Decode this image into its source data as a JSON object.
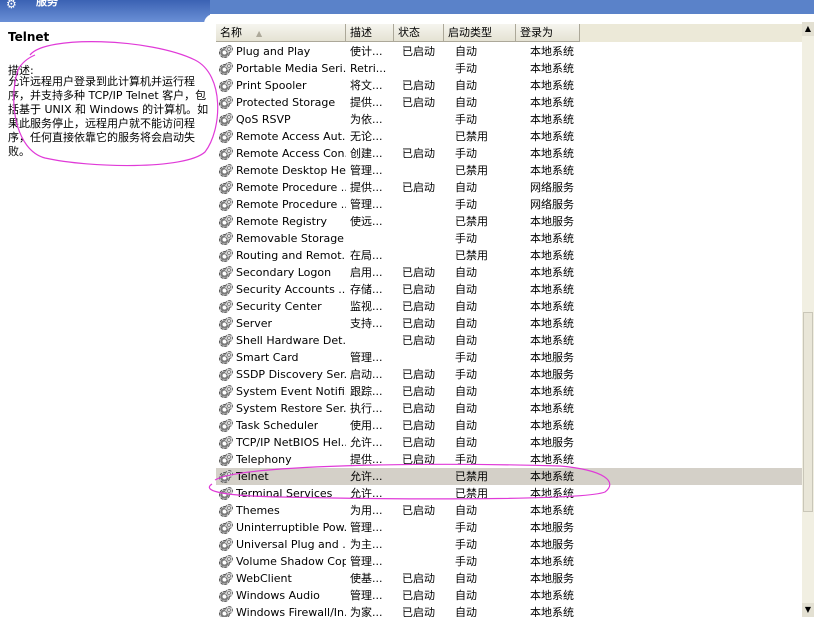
{
  "window": {
    "title": "服务"
  },
  "description_pane": {
    "service_name": "Telnet",
    "label": "描述:",
    "text": "允许远程用户登录到此计算机并运行程序，并支持多种 TCP/IP Telnet 客户，包括基于 UNIX 和 Windows 的计算机。如果此服务停止，远程用户就不能访问程序，任何直接依靠它的服务将会启动失败。"
  },
  "columns": {
    "name": "名称",
    "description": "描述",
    "status": "状态",
    "startup_type": "启动类型",
    "logon_as": "登录为"
  },
  "sort": {
    "column": "name",
    "indicator": "▲"
  },
  "rows": [
    {
      "name": "Plug and Play",
      "description": "使计...",
      "status": "已启动",
      "startup_type": "自动",
      "logon_as": "本地系统"
    },
    {
      "name": "Portable Media Seri...",
      "description": "Retri...",
      "status": "",
      "startup_type": "手动",
      "logon_as": "本地系统"
    },
    {
      "name": "Print Spooler",
      "description": "将文...",
      "status": "已启动",
      "startup_type": "自动",
      "logon_as": "本地系统"
    },
    {
      "name": "Protected Storage",
      "description": "提供...",
      "status": "已启动",
      "startup_type": "自动",
      "logon_as": "本地系统"
    },
    {
      "name": "QoS RSVP",
      "description": "为依...",
      "status": "",
      "startup_type": "手动",
      "logon_as": "本地系统"
    },
    {
      "name": "Remote Access Aut...",
      "description": "无论...",
      "status": "",
      "startup_type": "已禁用",
      "logon_as": "本地系统"
    },
    {
      "name": "Remote Access Con...",
      "description": "创建...",
      "status": "已启动",
      "startup_type": "手动",
      "logon_as": "本地系统"
    },
    {
      "name": "Remote Desktop He...",
      "description": "管理...",
      "status": "",
      "startup_type": "已禁用",
      "logon_as": "本地系统"
    },
    {
      "name": "Remote Procedure ...",
      "description": "提供...",
      "status": "已启动",
      "startup_type": "自动",
      "logon_as": "网络服务"
    },
    {
      "name": "Remote Procedure ...",
      "description": "管理...",
      "status": "",
      "startup_type": "手动",
      "logon_as": "网络服务"
    },
    {
      "name": "Remote Registry",
      "description": "使远...",
      "status": "",
      "startup_type": "已禁用",
      "logon_as": "本地服务"
    },
    {
      "name": "Removable Storage",
      "description": "",
      "status": "",
      "startup_type": "手动",
      "logon_as": "本地系统"
    },
    {
      "name": "Routing and Remot...",
      "description": "在局...",
      "status": "",
      "startup_type": "已禁用",
      "logon_as": "本地系统"
    },
    {
      "name": "Secondary Logon",
      "description": "启用...",
      "status": "已启动",
      "startup_type": "自动",
      "logon_as": "本地系统"
    },
    {
      "name": "Security Accounts ...",
      "description": "存储...",
      "status": "已启动",
      "startup_type": "自动",
      "logon_as": "本地系统"
    },
    {
      "name": "Security Center",
      "description": "监视...",
      "status": "已启动",
      "startup_type": "自动",
      "logon_as": "本地系统"
    },
    {
      "name": "Server",
      "description": "支持...",
      "status": "已启动",
      "startup_type": "自动",
      "logon_as": "本地系统"
    },
    {
      "name": "Shell Hardware Det...",
      "description": "",
      "status": "已启动",
      "startup_type": "自动",
      "logon_as": "本地系统"
    },
    {
      "name": "Smart Card",
      "description": "管理...",
      "status": "",
      "startup_type": "手动",
      "logon_as": "本地服务"
    },
    {
      "name": "SSDP Discovery Ser...",
      "description": "启动...",
      "status": "已启动",
      "startup_type": "手动",
      "logon_as": "本地服务"
    },
    {
      "name": "System Event Notifi...",
      "description": "跟踪...",
      "status": "已启动",
      "startup_type": "自动",
      "logon_as": "本地系统"
    },
    {
      "name": "System Restore Ser...",
      "description": "执行...",
      "status": "已启动",
      "startup_type": "自动",
      "logon_as": "本地系统"
    },
    {
      "name": "Task Scheduler",
      "description": "使用...",
      "status": "已启动",
      "startup_type": "自动",
      "logon_as": "本地系统"
    },
    {
      "name": "TCP/IP NetBIOS Hel...",
      "description": "允许...",
      "status": "已启动",
      "startup_type": "自动",
      "logon_as": "本地服务"
    },
    {
      "name": "Telephony",
      "description": "提供...",
      "status": "已启动",
      "startup_type": "手动",
      "logon_as": "本地系统"
    },
    {
      "name": "Telnet",
      "description": "允许...",
      "status": "",
      "startup_type": "已禁用",
      "logon_as": "本地系统",
      "selected": true
    },
    {
      "name": "Terminal Services",
      "description": "允许...",
      "status": "",
      "startup_type": "已禁用",
      "logon_as": "本地系统"
    },
    {
      "name": "Themes",
      "description": "为用...",
      "status": "已启动",
      "startup_type": "自动",
      "logon_as": "本地系统"
    },
    {
      "name": "Uninterruptible Pow...",
      "description": "管理...",
      "status": "",
      "startup_type": "手动",
      "logon_as": "本地服务"
    },
    {
      "name": "Universal Plug and ...",
      "description": "为主...",
      "status": "",
      "startup_type": "手动",
      "logon_as": "本地服务"
    },
    {
      "name": "Volume Shadow Copy",
      "description": "管理...",
      "status": "",
      "startup_type": "手动",
      "logon_as": "本地系统"
    },
    {
      "name": "WebClient",
      "description": "使基...",
      "status": "已启动",
      "startup_type": "自动",
      "logon_as": "本地服务"
    },
    {
      "name": "Windows Audio",
      "description": "管理...",
      "status": "已启动",
      "startup_type": "自动",
      "logon_as": "本地系统"
    },
    {
      "name": "Windows Firewall/In...",
      "description": "为家...",
      "status": "已启动",
      "startup_type": "自动",
      "logon_as": "本地系统"
    }
  ],
  "colors": {
    "title_bar": "#3b62b3",
    "annotation": "#e03ad8",
    "header_bg": "#ece9d8",
    "selected_row": "#d4d0c8"
  }
}
